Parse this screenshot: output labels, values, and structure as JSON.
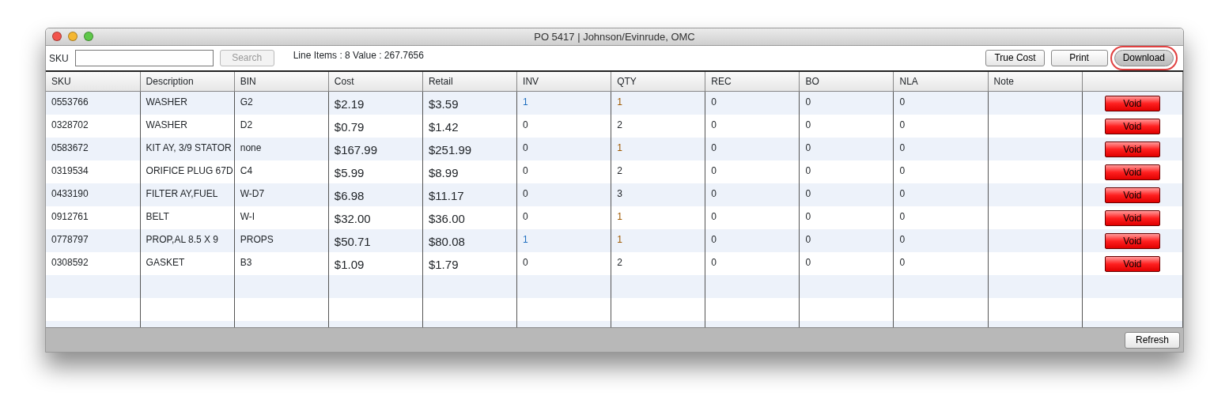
{
  "window": {
    "title": "PO 5417 | Johnson/Evinrude, OMC"
  },
  "toolbar": {
    "sku_label": "SKU",
    "search_button": {
      "label": "Search",
      "disabled": true
    },
    "summary": "Line Items : 8 Value : 267.7656",
    "buttons": [
      {
        "label": "True Cost",
        "highlighted": false
      },
      {
        "label": "Print",
        "highlighted": false
      },
      {
        "label": "Download",
        "highlighted": true
      }
    ]
  },
  "table": {
    "columns": [
      "SKU",
      "Description",
      "BIN",
      "Cost",
      "Retail",
      "INV",
      "QTY",
      "REC",
      "BO",
      "NLA",
      "Note"
    ],
    "rows": [
      {
        "sku": "0553766",
        "description": "WASHER",
        "bin": "G2",
        "cost": "$2.19",
        "retail": "$3.59",
        "inv": {
          "text": "1",
          "color": "#1f6fc0"
        },
        "qty": {
          "text": "1",
          "color": "#a05a00"
        },
        "rec": "0",
        "bo": "0",
        "nla": "0",
        "action": "Void"
      },
      {
        "sku": "0328702",
        "description": "WASHER",
        "bin": "D2",
        "cost": "$0.79",
        "retail": "$1.42",
        "inv": {
          "text": "0"
        },
        "qty": {
          "text": "2"
        },
        "rec": "0",
        "bo": "0",
        "nla": "0",
        "action": "Void"
      },
      {
        "sku": "0583672",
        "description": "KIT AY, 3/9 STATOR",
        "bin": "none",
        "cost": "$167.99",
        "retail": "$251.99",
        "inv": {
          "text": "0"
        },
        "qty": {
          "text": "1",
          "color": "#a05a00"
        },
        "rec": "0",
        "bo": "0",
        "nla": "0",
        "action": "Void"
      },
      {
        "sku": "0319534",
        "description": "ORIFICE PLUG 67D",
        "bin": "C4",
        "cost": "$5.99",
        "retail": "$8.99",
        "inv": {
          "text": "0"
        },
        "qty": {
          "text": "2"
        },
        "rec": "0",
        "bo": "0",
        "nla": "0",
        "action": "Void"
      },
      {
        "sku": "0433190",
        "description": "FILTER AY,FUEL",
        "bin": "W-D7",
        "cost": "$6.98",
        "retail": "$11.17",
        "inv": {
          "text": "0"
        },
        "qty": {
          "text": "3"
        },
        "rec": "0",
        "bo": "0",
        "nla": "0",
        "action": "Void"
      },
      {
        "sku": "0912761",
        "description": "BELT",
        "bin": "W-I",
        "cost": "$32.00",
        "retail": "$36.00",
        "inv": {
          "text": "0"
        },
        "qty": {
          "text": "1",
          "color": "#a05a00"
        },
        "rec": "0",
        "bo": "0",
        "nla": "0",
        "action": "Void"
      },
      {
        "sku": "0778797",
        "description": "PROP,AL 8.5 X 9",
        "bin": "PROPS",
        "cost": "$50.71",
        "retail": "$80.08",
        "inv": {
          "text": "1",
          "color": "#1f6fc0"
        },
        "qty": {
          "text": "1",
          "color": "#a05a00"
        },
        "rec": "0",
        "bo": "0",
        "nla": "0",
        "action": "Void"
      },
      {
        "sku": "0308592",
        "description": "GASKET",
        "bin": "B3",
        "cost": "$1.09",
        "retail": "$1.79",
        "inv": {
          "text": "0"
        },
        "qty": {
          "text": "2"
        },
        "rec": "0",
        "bo": "0",
        "nla": "0",
        "action": "Void"
      }
    ]
  },
  "footer": {
    "refresh_button": "Refresh"
  }
}
